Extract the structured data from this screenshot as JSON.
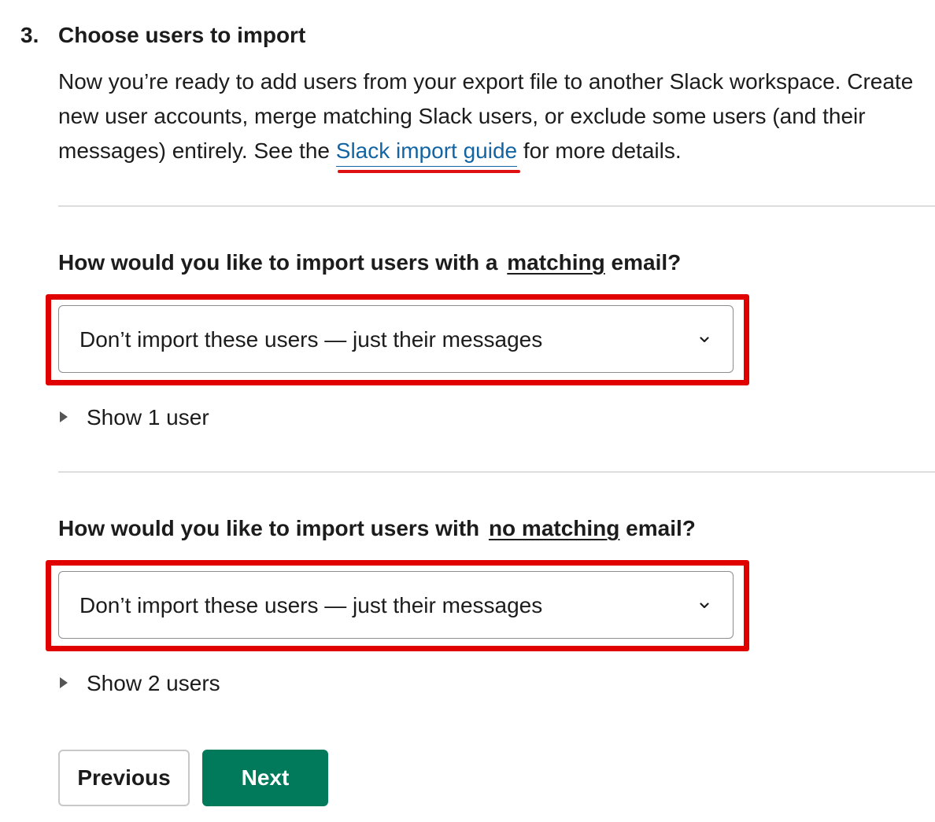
{
  "step": {
    "number": "3.",
    "title": "Choose users to import"
  },
  "intro": {
    "text_before_link": "Now you’re ready to add users from your export file to another Slack workspace. Create new user accounts, merge matching Slack users, or exclude some users (and their messages) entirely. See the ",
    "link_text": "Slack import guide",
    "text_after_link": " for more details."
  },
  "matching_section": {
    "question_prefix": "How would you like to import users with a",
    "question_emph": "matching",
    "question_suffix": " email?",
    "select_value": "Don’t import these users — just their messages",
    "toggle_label": "Show 1 user"
  },
  "no_matching_section": {
    "question_prefix": "How would you like to import users with",
    "question_emph": "no matching",
    "question_suffix": " email?",
    "select_value": "Don’t import these users — just their messages",
    "toggle_label": "Show 2 users"
  },
  "buttons": {
    "previous_label": "Previous",
    "next_label": "Next"
  },
  "colors": {
    "link": "#1264a3",
    "highlight": "#e00000",
    "primary_button": "#007a5a"
  },
  "icons": {
    "select_chevron": "chevron-down-icon",
    "disclosure": "triangle-right-icon"
  }
}
